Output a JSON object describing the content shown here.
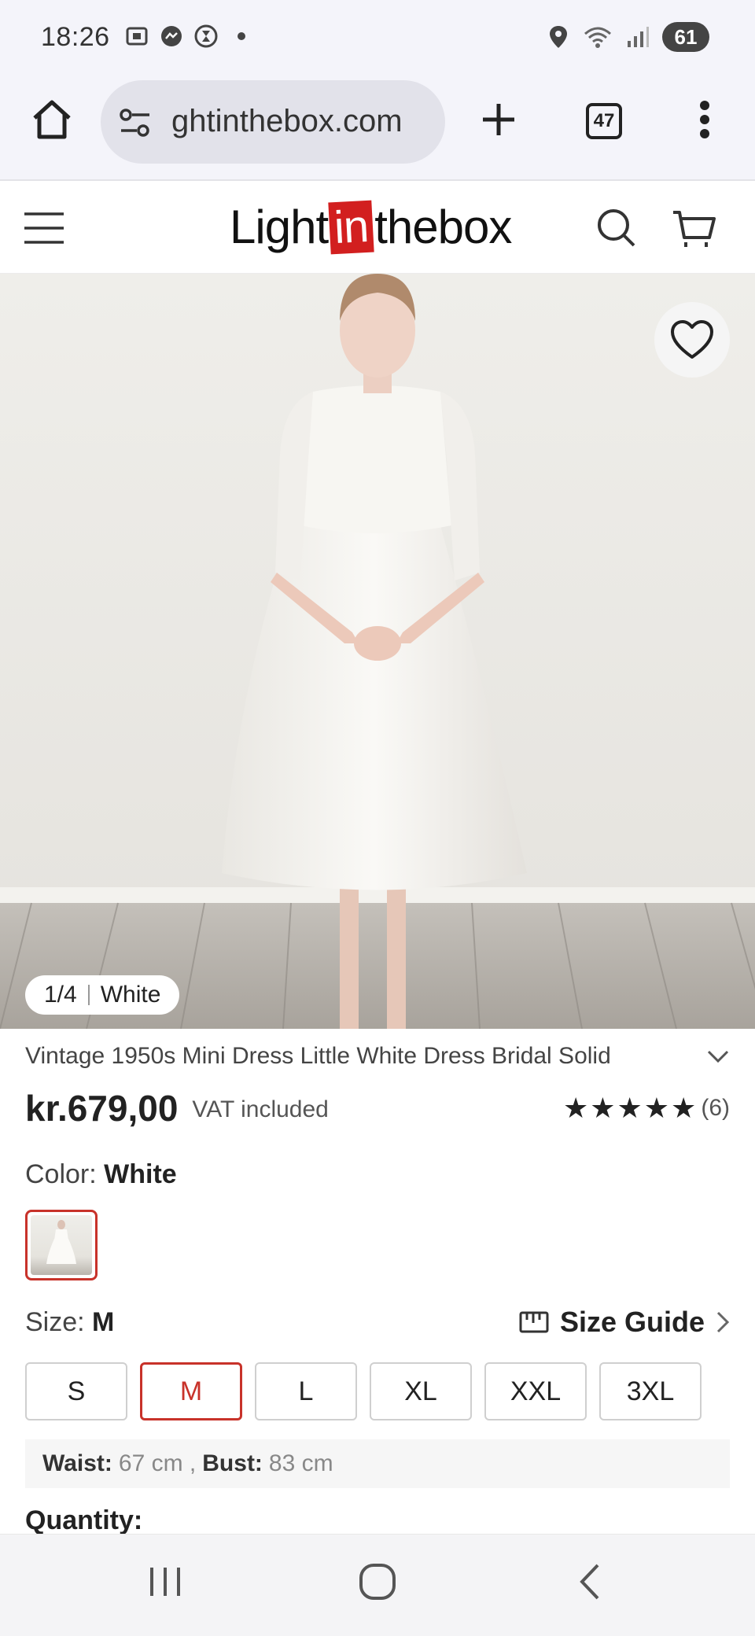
{
  "status_bar": {
    "time": "18:26",
    "battery": "61"
  },
  "browser": {
    "url": "ghtinthebox.com",
    "tab_count": "47"
  },
  "site": {
    "logo_left": "Light",
    "logo_mid": "in",
    "logo_right": "thebox"
  },
  "gallery": {
    "counter": "1/4",
    "color_name": "White"
  },
  "product": {
    "title": "Vintage 1950s Mini Dress Little White Dress Bridal Solid",
    "price": "kr.679,00",
    "vat_note": "VAT included",
    "rating_stars": 5,
    "review_count": "(6)",
    "color_label": "Color:",
    "color_value": "White",
    "size_label": "Size:",
    "size_value": "M",
    "size_guide_label": "Size Guide",
    "sizes": [
      "S",
      "M",
      "L",
      "XL",
      "XXL",
      "3XL"
    ],
    "selected_size": "M",
    "measurements": {
      "waist_label": "Waist:",
      "waist_value": "67 cm ,",
      "bust_label": "Bust:",
      "bust_value": "83 cm"
    },
    "quantity_label": "Quantity:"
  },
  "colors": {
    "accent": "#c8322a",
    "logo_red": "#d21f1f"
  }
}
